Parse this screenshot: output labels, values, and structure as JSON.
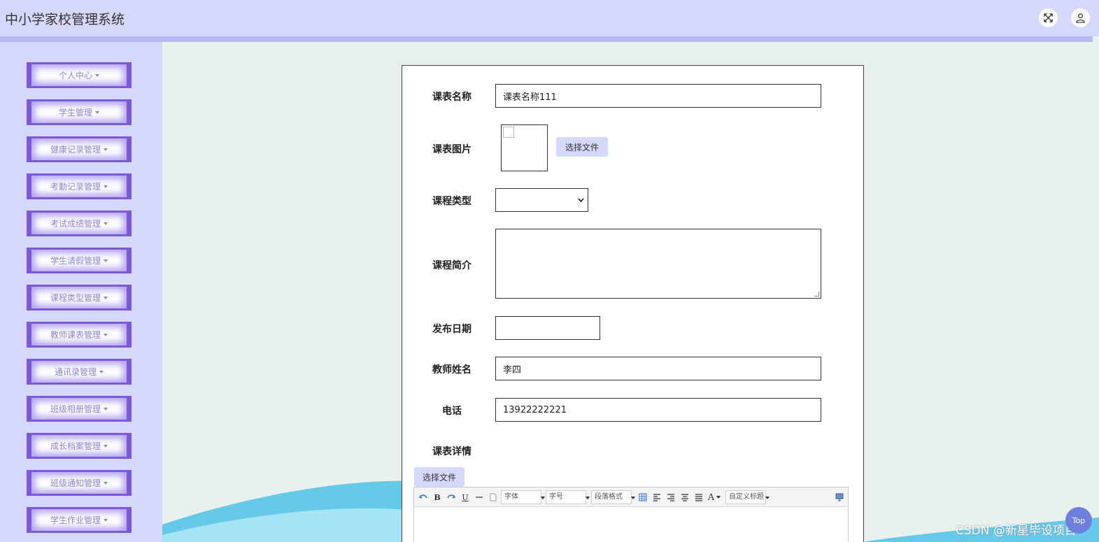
{
  "header": {
    "title": "中小学家校管理系统",
    "fullscreen_icon": "expand-icon",
    "user_icon": "user-icon"
  },
  "sidebar": {
    "items": [
      {
        "label": "个人中心"
      },
      {
        "label": "学生管理"
      },
      {
        "label": "健康记录管理"
      },
      {
        "label": "考勤记录管理"
      },
      {
        "label": "考试成绩管理"
      },
      {
        "label": "学生请假管理"
      },
      {
        "label": "课程类型管理"
      },
      {
        "label": "教师课表管理"
      },
      {
        "label": "通讯录管理"
      },
      {
        "label": "班级相册管理"
      },
      {
        "label": "成长档案管理"
      },
      {
        "label": "班级通知管理"
      },
      {
        "label": "学生作业管理"
      }
    ]
  },
  "form": {
    "course_name": {
      "label": "课表名称",
      "value": "课表名称111"
    },
    "course_image": {
      "label": "课表图片",
      "button": "选择文件"
    },
    "course_type": {
      "label": "课程类型",
      "value": ""
    },
    "course_intro": {
      "label": "课程简介",
      "value": ""
    },
    "publish_date": {
      "label": "发布日期",
      "value": ""
    },
    "teacher_name": {
      "label": "教师姓名",
      "value": "李四"
    },
    "phone": {
      "label": "电话",
      "value": "13922222221"
    },
    "details": {
      "label": "课表详情",
      "button": "选择文件"
    }
  },
  "editor": {
    "font_family": "字体",
    "font_size": "字号",
    "paragraph": "段落格式",
    "custom_title": "自定义标题",
    "bold": "B",
    "underline": "U",
    "font_color": "A"
  },
  "watermark": "CSDN @新星毕设项目",
  "top_button": "Top",
  "colors": {
    "header_bg": "#d6d8fb",
    "menu_accent": "#7b59d9",
    "content_bg": "#e8f1ec"
  }
}
